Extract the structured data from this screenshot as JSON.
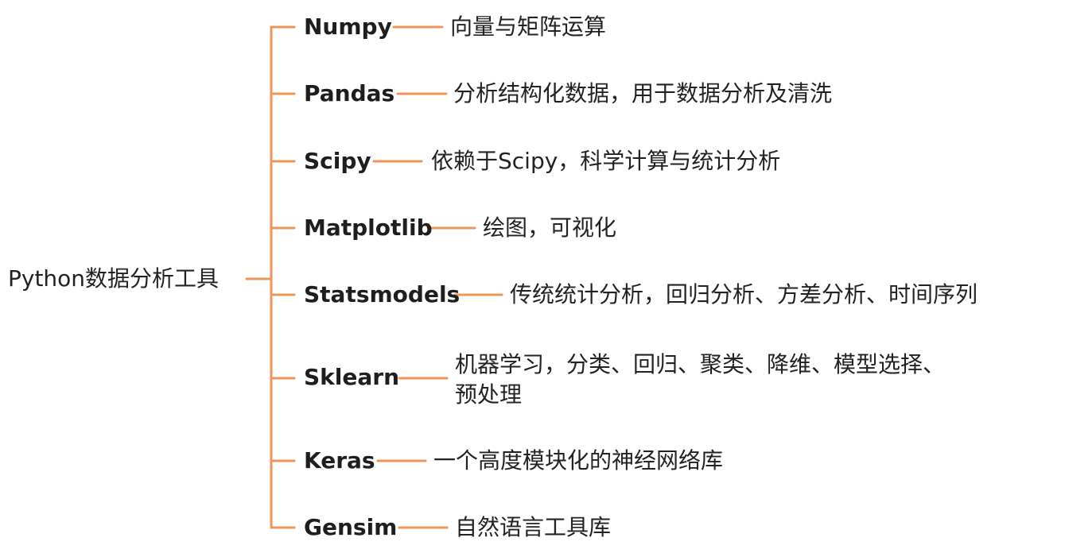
{
  "root": {
    "label": "Python数据分析工具"
  },
  "branches": [
    {
      "lib": "Numpy",
      "desc": "向量与矩阵运算"
    },
    {
      "lib": "Pandas",
      "desc": "分析结构化数据，用于数据分析及清洗"
    },
    {
      "lib": "Scipy",
      "desc": "依赖于Scipy，科学计算与统计分析"
    },
    {
      "lib": "Matplotlib",
      "desc": "绘图，可视化"
    },
    {
      "lib": "Statsmodels",
      "desc": "传统统计分析，回归分析、方差分析、时间序列"
    },
    {
      "lib": "Sklearn",
      "desc": "机器学习，分类、回归、聚类、降维、模型选择、预处理"
    },
    {
      "lib": "Keras",
      "desc": "一个高度模块化的神经网络库"
    },
    {
      "lib": "Gensim",
      "desc": "自然语言工具库"
    }
  ],
  "colors": {
    "connector": "#f0955a"
  }
}
